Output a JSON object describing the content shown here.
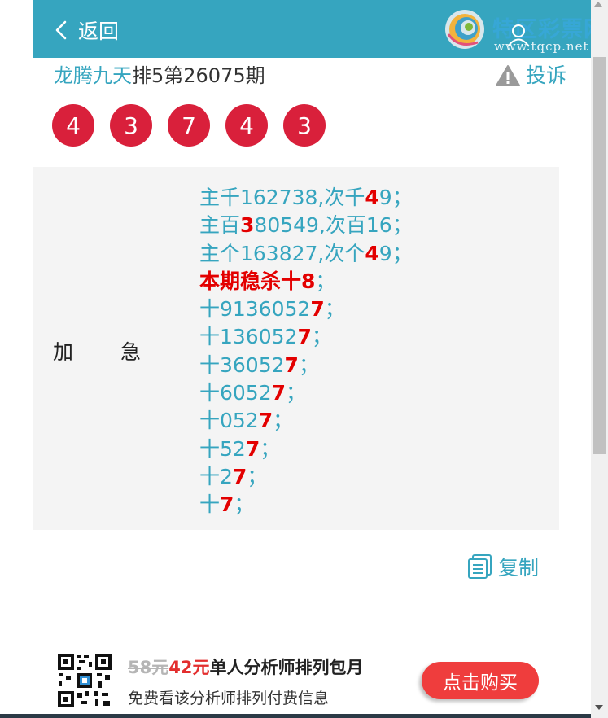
{
  "header": {
    "back_label": "返回",
    "logo_name": "特区彩票网",
    "logo_url": "www.tqcp.net",
    "bg_color": "#36a5bf"
  },
  "title": {
    "author": "龙腾九天",
    "issue": "排5第26075期"
  },
  "complain_label": "投诉",
  "balls": [
    "4",
    "3",
    "7",
    "4",
    "3"
  ],
  "ball_color": "#d9203b",
  "content": {
    "label_1": "加",
    "label_2": "急",
    "lines": [
      [
        {
          "t": "主千162738,次千",
          "h": false
        },
        {
          "t": "4",
          "h": true
        },
        {
          "t": "9；",
          "h": false
        }
      ],
      [
        {
          "t": "主百",
          "h": false
        },
        {
          "t": "3",
          "h": true
        },
        {
          "t": "80549,次百16；",
          "h": false
        }
      ],
      [
        {
          "t": "主个163827,次个",
          "h": false
        },
        {
          "t": "4",
          "h": true
        },
        {
          "t": "9；",
          "h": false
        }
      ],
      [
        {
          "t": "本期稳杀十8",
          "h": true
        },
        {
          "t": "；",
          "h": false
        }
      ],
      [
        {
          "t": "十9136052",
          "h": false
        },
        {
          "t": "7",
          "h": true
        },
        {
          "t": "；",
          "h": false
        }
      ],
      [
        {
          "t": "十136052",
          "h": false
        },
        {
          "t": "7",
          "h": true
        },
        {
          "t": "；",
          "h": false
        }
      ],
      [
        {
          "t": "十36052",
          "h": false
        },
        {
          "t": "7",
          "h": true
        },
        {
          "t": "；",
          "h": false
        }
      ],
      [
        {
          "t": "十6052",
          "h": false
        },
        {
          "t": "7",
          "h": true
        },
        {
          "t": "；",
          "h": false
        }
      ],
      [
        {
          "t": "十052",
          "h": false
        },
        {
          "t": "7",
          "h": true
        },
        {
          "t": "；",
          "h": false
        }
      ],
      [
        {
          "t": "十52",
          "h": false
        },
        {
          "t": "7",
          "h": true
        },
        {
          "t": "；",
          "h": false
        }
      ],
      [
        {
          "t": "十2",
          "h": false
        },
        {
          "t": "7",
          "h": true
        },
        {
          "t": "；",
          "h": false
        }
      ],
      [
        {
          "t": "十",
          "h": false
        },
        {
          "t": "7",
          "h": true
        },
        {
          "t": "；",
          "h": false
        }
      ]
    ]
  },
  "copy_label": "复制",
  "promo": {
    "old_price": "58元",
    "new_price": "42元",
    "title": "单人分析师排列包月",
    "subtitle": "免费看该分析师排列付费信息",
    "buy_label": "点击购买"
  }
}
